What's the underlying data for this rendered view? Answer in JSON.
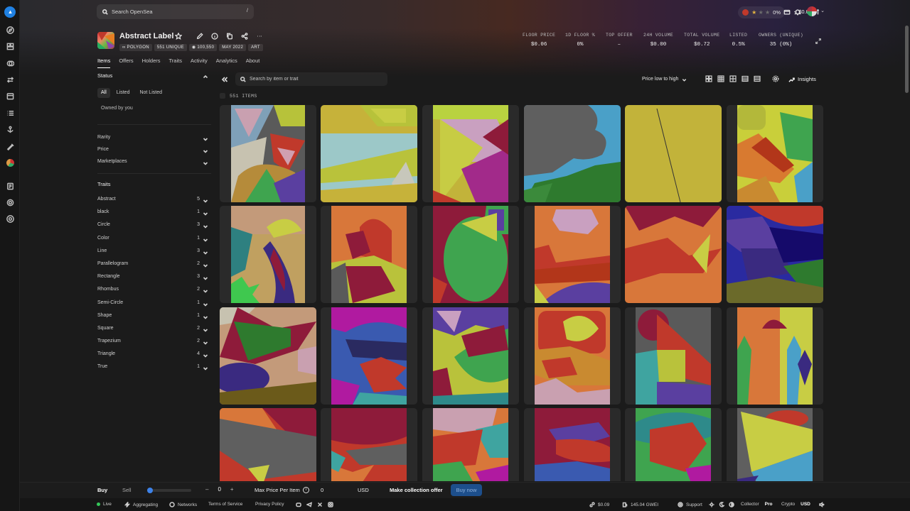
{
  "topbar": {
    "search_placeholder": "Search OpenSea",
    "search_shortcut": "/",
    "rating_percent": "0%",
    "stars_filled": 1,
    "wallet_balance": "< $0.01"
  },
  "collection": {
    "title": "Abstract Label",
    "tags": [
      "POLYGON",
      "551 UNIQUE",
      "100,550",
      "MAY 2022",
      "ART"
    ]
  },
  "stats": [
    {
      "label": "FLOOR PRICE",
      "value": "$0.06"
    },
    {
      "label": "1D FLOOR %",
      "value": "0%"
    },
    {
      "label": "TOP OFFER",
      "value": "–"
    },
    {
      "label": "24H VOLUME",
      "value": "$0.00"
    },
    {
      "label": "TOTAL VOLUME",
      "value": "$0.72"
    },
    {
      "label": "LISTED",
      "value": "0.5%"
    },
    {
      "label": "OWNERS (UNIQUE)",
      "value": "35 (0%)"
    }
  ],
  "tabs": [
    "Items",
    "Offers",
    "Holders",
    "Traits",
    "Activity",
    "Analytics",
    "About"
  ],
  "sidebar": {
    "status_title": "Status",
    "status_options": [
      "All",
      "Listed",
      "Not Listed"
    ],
    "owned_by_you": "Owned by you",
    "filters": [
      "Rarity",
      "Price",
      "Marketplaces"
    ],
    "traits_title": "Traits",
    "traits": [
      {
        "name": "Abstract",
        "count": "5"
      },
      {
        "name": "black",
        "count": "1"
      },
      {
        "name": "Circle",
        "count": "3"
      },
      {
        "name": "Color",
        "count": "1"
      },
      {
        "name": "Line",
        "count": "3"
      },
      {
        "name": "Parallelogram",
        "count": "2"
      },
      {
        "name": "Rectangle",
        "count": "3"
      },
      {
        "name": "Rhombus",
        "count": "2"
      },
      {
        "name": "Semi-Circle",
        "count": "1"
      },
      {
        "name": "Shape",
        "count": "1"
      },
      {
        "name": "Square",
        "count": "2"
      },
      {
        "name": "Trapezium",
        "count": "2"
      },
      {
        "name": "Triangle",
        "count": "4"
      },
      {
        "name": "True",
        "count": "1"
      }
    ]
  },
  "toolbar": {
    "search_placeholder": "Search by item or trait",
    "sort_label": "Price low to high",
    "insights_label": "Insights",
    "items_count": "551 ITEMS"
  },
  "bottombar": {
    "buy_label": "Buy",
    "sell_label": "Sell",
    "quantity": "0",
    "max_price_label": "Max Price Per Item",
    "max_price_value": "0",
    "currency": "USD",
    "collection_offer_label": "Make collection offer",
    "buy_now_label": "Buy now"
  },
  "footer": {
    "live": "Live",
    "aggregating": "Aggregating",
    "networks": "Networks",
    "terms": "Terms of Service",
    "privacy": "Privacy Policy",
    "eth_price": "$0.09",
    "gas": "145.04 GWEI",
    "support": "Support",
    "collector": "Collector",
    "pro": "Pro",
    "crypto": "Crypto",
    "usd": "USD"
  }
}
